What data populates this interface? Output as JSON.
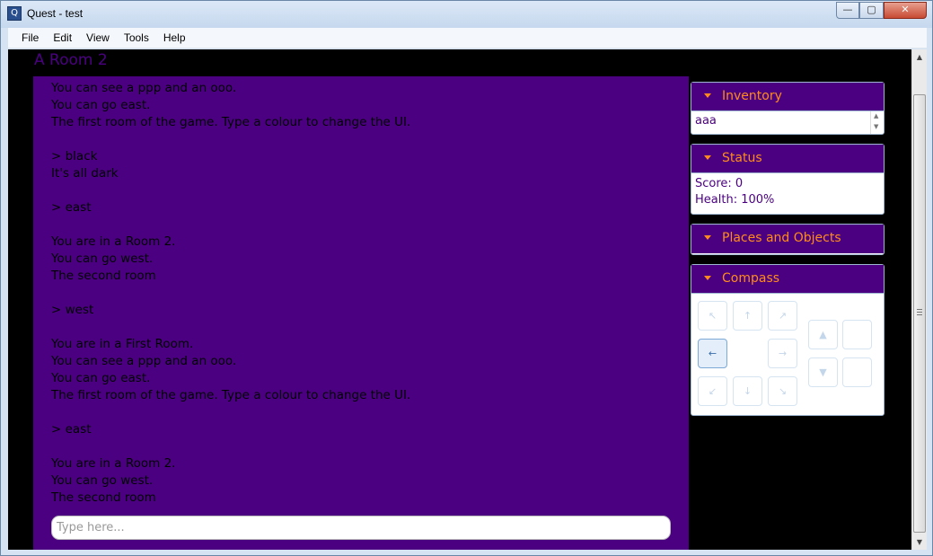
{
  "window": {
    "title": "Quest - test",
    "minimize_glyph": "—",
    "maximize_glyph": "▢",
    "close_glyph": "✕"
  },
  "menu": [
    "File",
    "Edit",
    "View",
    "Tools",
    "Help"
  ],
  "room_title": "A Room 2",
  "output_lines": [
    "You can see a ppp and an ooo.",
    "You can go east.",
    "The first room of the game. Type a colour to change the UI.",
    "",
    "> black",
    "It's all dark",
    "",
    "> east",
    "",
    "You are in a Room 2.",
    "You can go west.",
    "The second room",
    "",
    "> west",
    "",
    "You are in a First Room.",
    "You can see a ppp and an ooo.",
    "You can go east.",
    "The first room of the game. Type a colour to change the UI.",
    "",
    "> east",
    "",
    "You are in a Room 2.",
    "You can go west.",
    "The second room"
  ],
  "command_input": {
    "placeholder": "Type here...",
    "value": ""
  },
  "panes": {
    "inventory": {
      "title": "Inventory",
      "items": [
        "aaa"
      ]
    },
    "status": {
      "title": "Status",
      "lines": [
        "Score: 0",
        "Health: 100%"
      ]
    },
    "places": {
      "title": "Places and Objects"
    },
    "compass": {
      "title": "Compass",
      "directions": {
        "northwest": "↖",
        "north": "↑",
        "northeast": "↗",
        "west": "←",
        "east": "→",
        "southwest": "↙",
        "south": "↓",
        "southeast": "↘",
        "up": "▲",
        "down": "▼",
        "in": "",
        "out": ""
      },
      "active": [
        "west"
      ]
    }
  },
  "colors": {
    "theme_background": "#4b0082",
    "theme_accent": "#ff8c1a",
    "page_background": "#000000"
  }
}
